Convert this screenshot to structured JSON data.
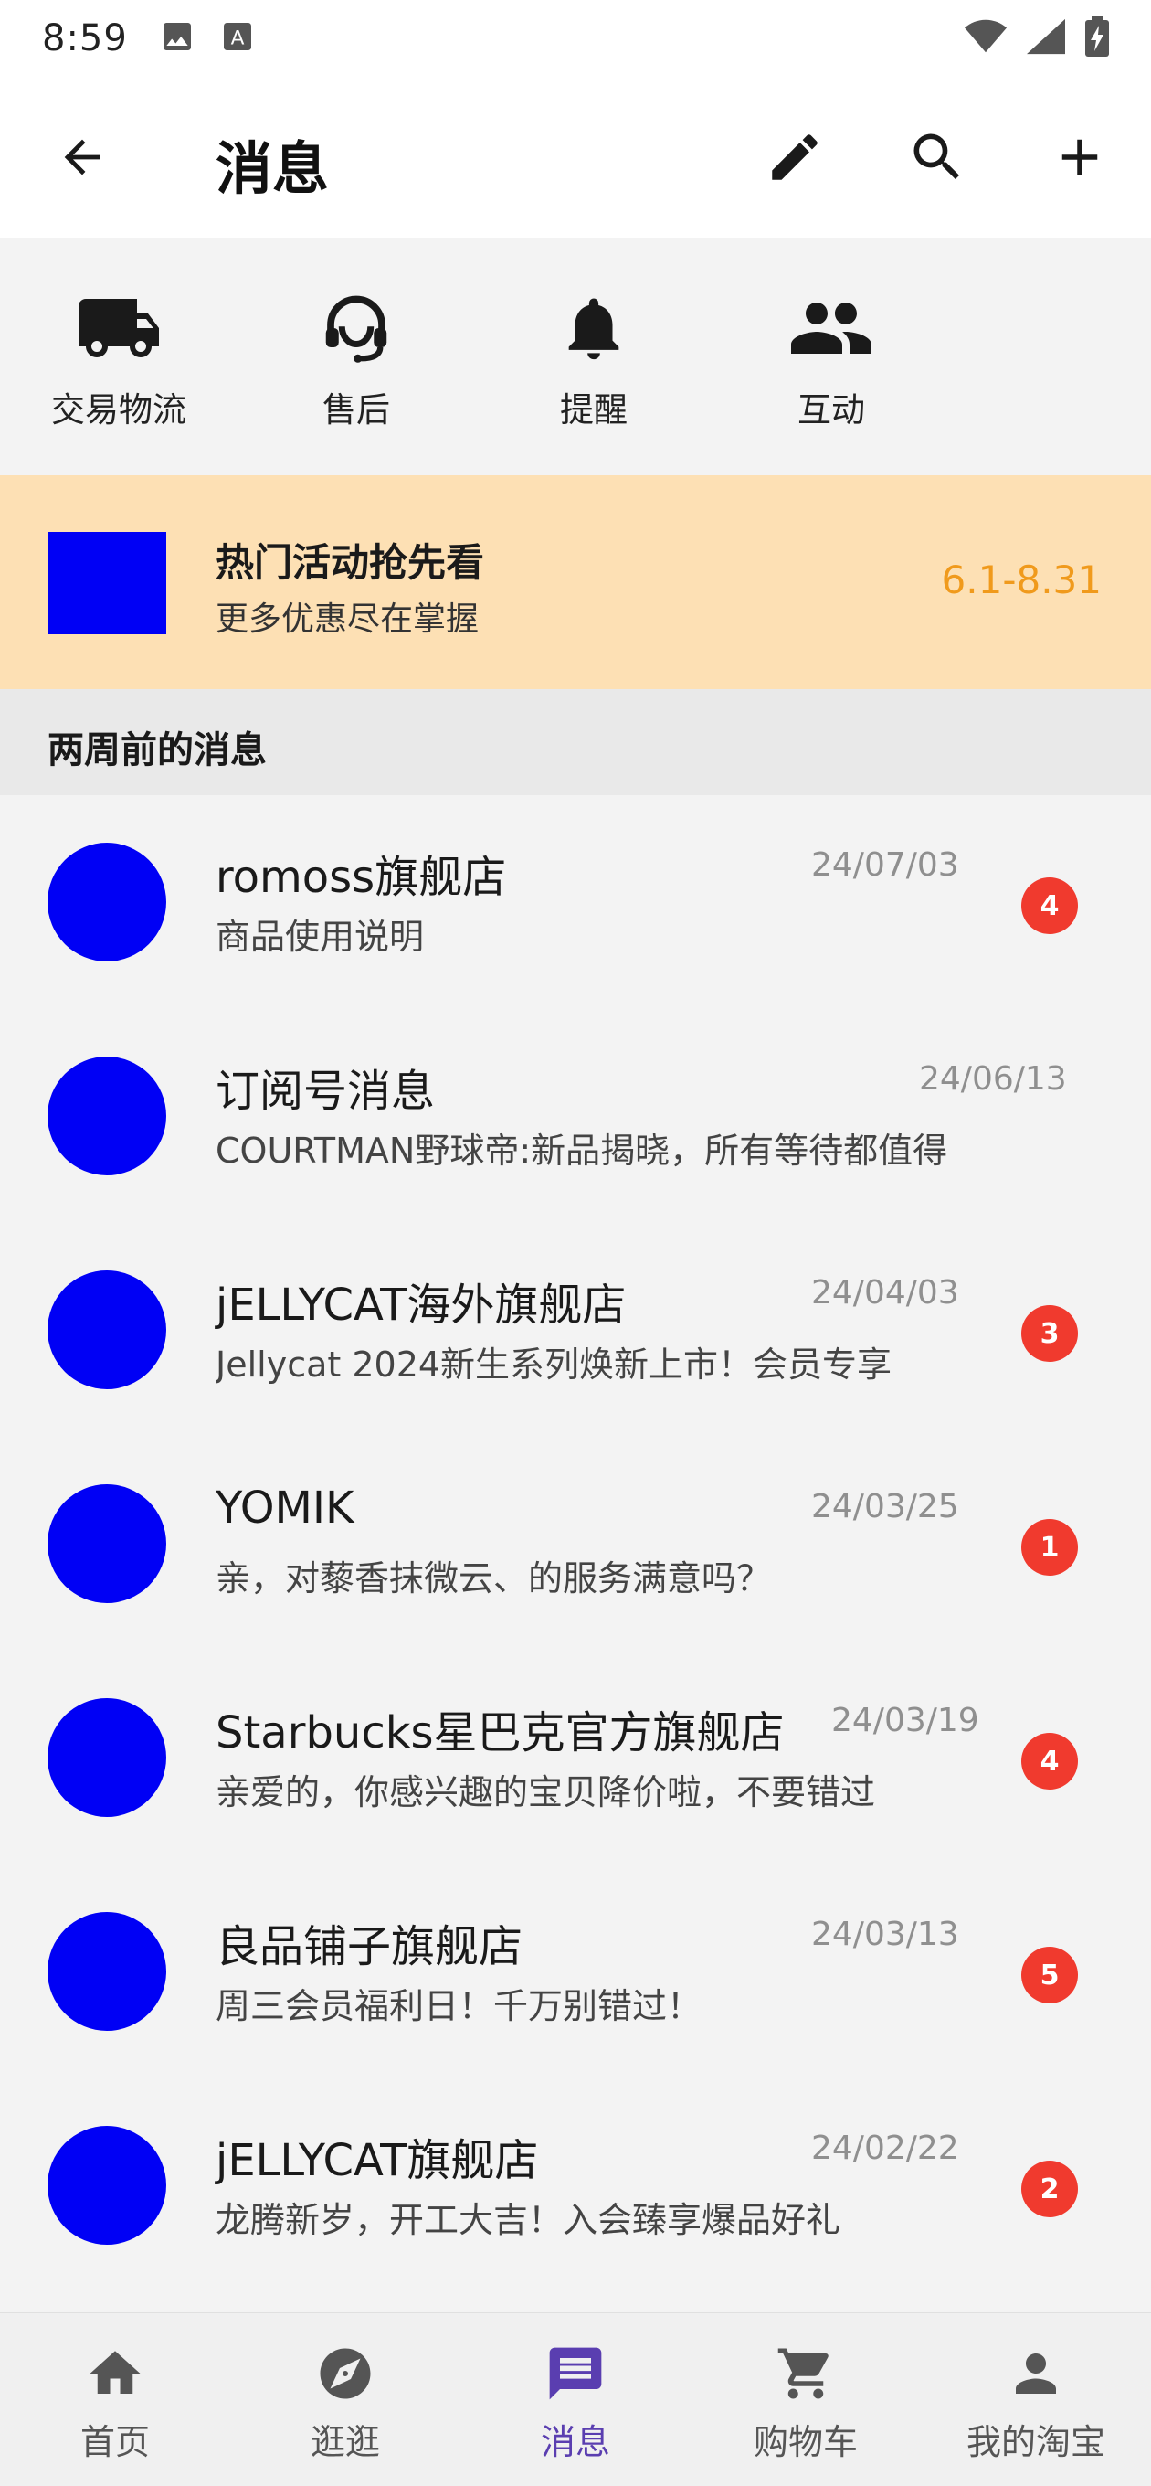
{
  "status_bar": {
    "time": "8:59"
  },
  "header": {
    "title": "消息"
  },
  "categories": [
    {
      "label": "交易物流",
      "icon": "truck-icon"
    },
    {
      "label": "售后",
      "icon": "headset-agent-icon"
    },
    {
      "label": "提醒",
      "icon": "bell-icon"
    },
    {
      "label": "互动",
      "icon": "people-icon"
    }
  ],
  "promo": {
    "title": "热门活动抢先看",
    "subtitle": "更多优惠尽在掌握",
    "date_range": "6.1-8.31"
  },
  "section": {
    "title": "两周前的消息"
  },
  "messages": [
    {
      "name": "romoss旗舰店",
      "preview": "商品使用说明",
      "time": "24/07/03",
      "badge": "4"
    },
    {
      "name": "订阅号消息",
      "preview": "COURTMAN野球帝:新品揭晓，所有等待都值得",
      "time": "24/06/13",
      "badge": ""
    },
    {
      "name": "jELLYCAT海外旗舰店",
      "preview": "Jellycat 2024新生系列焕新上市！会员专享",
      "time": "24/04/03",
      "badge": "3"
    },
    {
      "name": "YOMIK",
      "preview": "亲，对藜香抹微云、的服务满意吗？",
      "time": "24/03/25",
      "badge": "1"
    },
    {
      "name": "Starbucks星巴克官方旗舰店",
      "preview": "亲爱的，你感兴趣的宝贝降价啦，不要错过",
      "time": "24/03/19",
      "badge": "4"
    },
    {
      "name": "良品铺子旗舰店",
      "preview": "周三会员福利日！千万别错过！",
      "time": "24/03/13",
      "badge": "5"
    },
    {
      "name": "jELLYCAT旗舰店",
      "preview": "龙腾新岁，开工大吉！入会臻享爆品好礼",
      "time": "24/02/22",
      "badge": "2"
    }
  ],
  "bottom_nav": [
    {
      "label": "首页",
      "icon": "home-icon"
    },
    {
      "label": "逛逛",
      "icon": "compass-icon"
    },
    {
      "label": "消息",
      "icon": "message-icon",
      "active": true
    },
    {
      "label": "购物车",
      "icon": "cart-icon"
    },
    {
      "label": "我的淘宝",
      "icon": "person-icon"
    }
  ],
  "colors": {
    "accent": "#5a3eb0",
    "badge": "#f03a2e",
    "promo_bg": "#fde0b4",
    "promo_date": "#f09a1c",
    "placeholder": "#0000f5"
  }
}
